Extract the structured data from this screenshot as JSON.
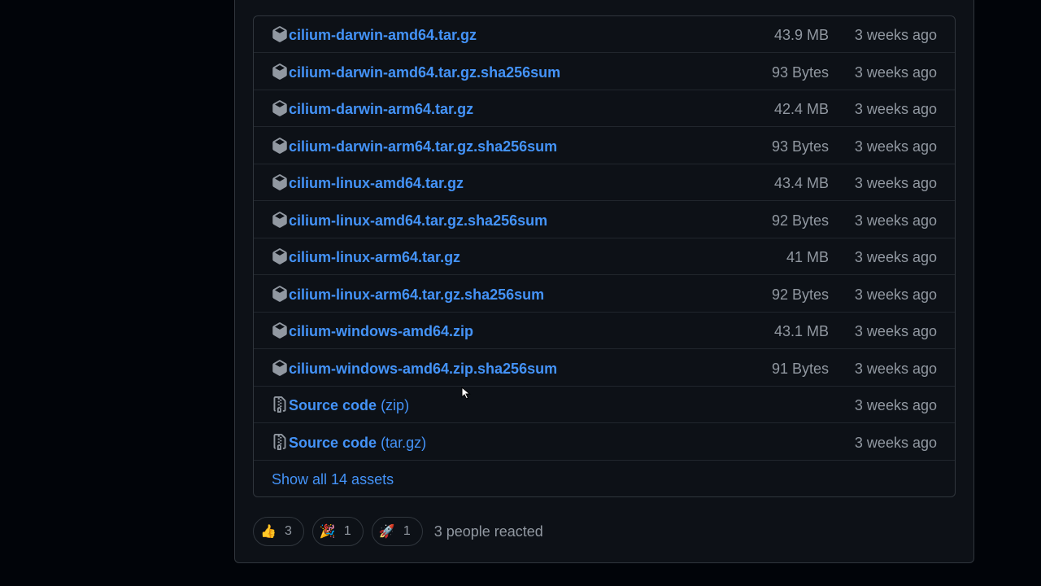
{
  "assets": [
    {
      "name": "cilium-darwin-amd64.tar.gz",
      "size": "43.9 MB",
      "date": "3 weeks ago"
    },
    {
      "name": "cilium-darwin-amd64.tar.gz.sha256sum",
      "size": "93 Bytes",
      "date": "3 weeks ago"
    },
    {
      "name": "cilium-darwin-arm64.tar.gz",
      "size": "42.4 MB",
      "date": "3 weeks ago"
    },
    {
      "name": "cilium-darwin-arm64.tar.gz.sha256sum",
      "size": "93 Bytes",
      "date": "3 weeks ago"
    },
    {
      "name": "cilium-linux-amd64.tar.gz",
      "size": "43.4 MB",
      "date": "3 weeks ago"
    },
    {
      "name": "cilium-linux-amd64.tar.gz.sha256sum",
      "size": "92 Bytes",
      "date": "3 weeks ago"
    },
    {
      "name": "cilium-linux-arm64.tar.gz",
      "size": "41 MB",
      "date": "3 weeks ago"
    },
    {
      "name": "cilium-linux-arm64.tar.gz.sha256sum",
      "size": "92 Bytes",
      "date": "3 weeks ago"
    },
    {
      "name": "cilium-windows-amd64.zip",
      "size": "43.1 MB",
      "date": "3 weeks ago"
    },
    {
      "name": "cilium-windows-amd64.zip.sha256sum",
      "size": "91 Bytes",
      "date": "3 weeks ago"
    }
  ],
  "source_code": [
    {
      "label": "Source code",
      "suffix": "(zip)",
      "date": "3 weeks ago"
    },
    {
      "label": "Source code",
      "suffix": "(tar.gz)",
      "date": "3 weeks ago"
    }
  ],
  "show_all": "Show all 14 assets",
  "reactions": {
    "items": [
      {
        "icon": "thumbs-up-icon",
        "glyph": "👍",
        "count": "3"
      },
      {
        "icon": "tada-icon",
        "glyph": "🎉",
        "count": "1"
      },
      {
        "icon": "rocket-icon",
        "glyph": "🚀",
        "count": "1"
      }
    ],
    "summary": "3 people reacted"
  },
  "colors": {
    "link": "#4493f8",
    "muted": "#9198a1",
    "border": "#30363d",
    "background": "#0d1117"
  }
}
